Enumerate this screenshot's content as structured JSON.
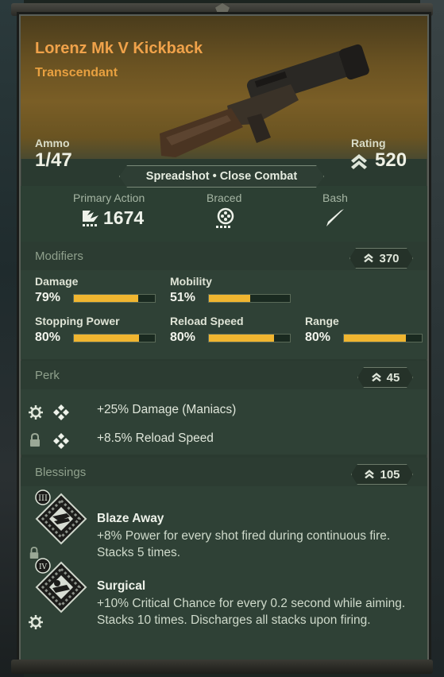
{
  "item": {
    "name": "Lorenz Mk V Kickback",
    "rarity": "Transcendant",
    "ammo_label": "Ammo",
    "ammo_value": "1/47",
    "rating_label": "Rating",
    "rating_value": "520",
    "special": "Spreadshot • Close Combat"
  },
  "actions": {
    "primary_label": "Primary Action",
    "primary_value": "1674",
    "braced_label": "Braced",
    "bash_label": "Bash"
  },
  "modifiers": {
    "title": "Modifiers",
    "score": "370",
    "stats": [
      {
        "name": "Damage",
        "value": "79%",
        "fraction": 0.79
      },
      {
        "name": "Mobility",
        "value": "51%",
        "fraction": 0.51
      },
      {
        "name": "Stopping Power",
        "value": "80%",
        "fraction": 0.8
      },
      {
        "name": "Reload Speed",
        "value": "80%",
        "fraction": 0.8
      },
      {
        "name": "Range",
        "value": "80%",
        "fraction": 0.8
      }
    ]
  },
  "perk": {
    "title": "Perk",
    "score": "45",
    "items": [
      {
        "text": "+25%  Damage (Maniacs)",
        "status_icon": "gear-icon"
      },
      {
        "text": "+8.5% Reload Speed",
        "status_icon": "lock-icon"
      }
    ]
  },
  "blessings": {
    "title": "Blessings",
    "score": "105",
    "items": [
      {
        "tier": "III",
        "name": "Blaze Away",
        "desc": "+8% Power for every shot fired during continuous fire. Stacks 5 times.",
        "status_icon": "lock-icon"
      },
      {
        "tier": "IV",
        "name": "Surgical",
        "desc": "+10% Critical Chance for every 0.2 second while aiming. Stacks 10 times. Discharges all stacks upon firing.",
        "status_icon": "gear-icon"
      }
    ]
  },
  "colors": {
    "rarity_orange": "#f0a24a",
    "bar_fill": "#f0b530",
    "panel_green": "#2f4136"
  }
}
